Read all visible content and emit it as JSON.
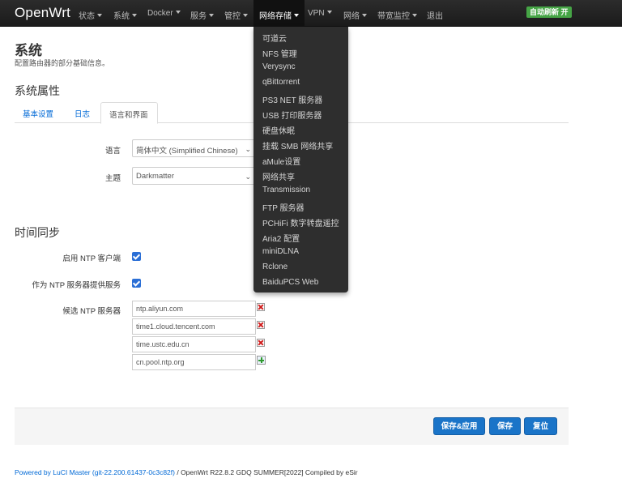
{
  "navbar": {
    "brand": "OpenWrt",
    "items": [
      "状态",
      "系统",
      "Docker",
      "服务",
      "管控",
      "网络存储",
      "VPN",
      "网络",
      "带宽监控",
      "退出"
    ],
    "active_index": 5,
    "refresh_badge": "自动刷新 开"
  },
  "dropdown": {
    "items": [
      "可道云",
      "NFS 管理",
      "Verysync",
      "qBittorrent",
      "PS3 NET 服务器",
      "USB 打印服务器",
      "硬盘休眠",
      "挂载 SMB 网络共享",
      "aMule设置",
      "网络共享",
      "Transmission",
      "FTP 服务器",
      "PCHiFi 数字转盘遥控",
      "Aria2 配置",
      "miniDLNA",
      "Rclone",
      "BaiduPCS Web"
    ]
  },
  "page": {
    "title": "系统",
    "description": "配置路由器的部分基础信息。"
  },
  "system_properties": {
    "title": "系统属性",
    "tabs": [
      "基本设置",
      "日志",
      "语言和界面"
    ],
    "active_tab": 2,
    "language_label": "语言",
    "language_value": "简体中文 (Simplified Chinese)",
    "theme_label": "主题",
    "theme_value": "Darkmatter"
  },
  "time_sync": {
    "title": "时间同步",
    "enable_ntp_label": "启用 NTP 客户端",
    "ntp_server_label": "作为 NTP 服务器提供服务",
    "candidate_label": "候选 NTP 服务器",
    "servers": [
      "ntp.aliyun.com",
      "time1.cloud.tencent.com",
      "time.ustc.edu.cn",
      "cn.pool.ntp.org"
    ]
  },
  "actions": {
    "save_apply": "保存&应用",
    "save": "保存",
    "reset": "复位"
  },
  "footer": {
    "link_text": "Powered by LuCI Master (git-22.200.61437-0c3c82f)",
    "rest_text": " / OpenWrt R22.8.2 GDQ SUMMER[2022] Compiled by eSir"
  }
}
